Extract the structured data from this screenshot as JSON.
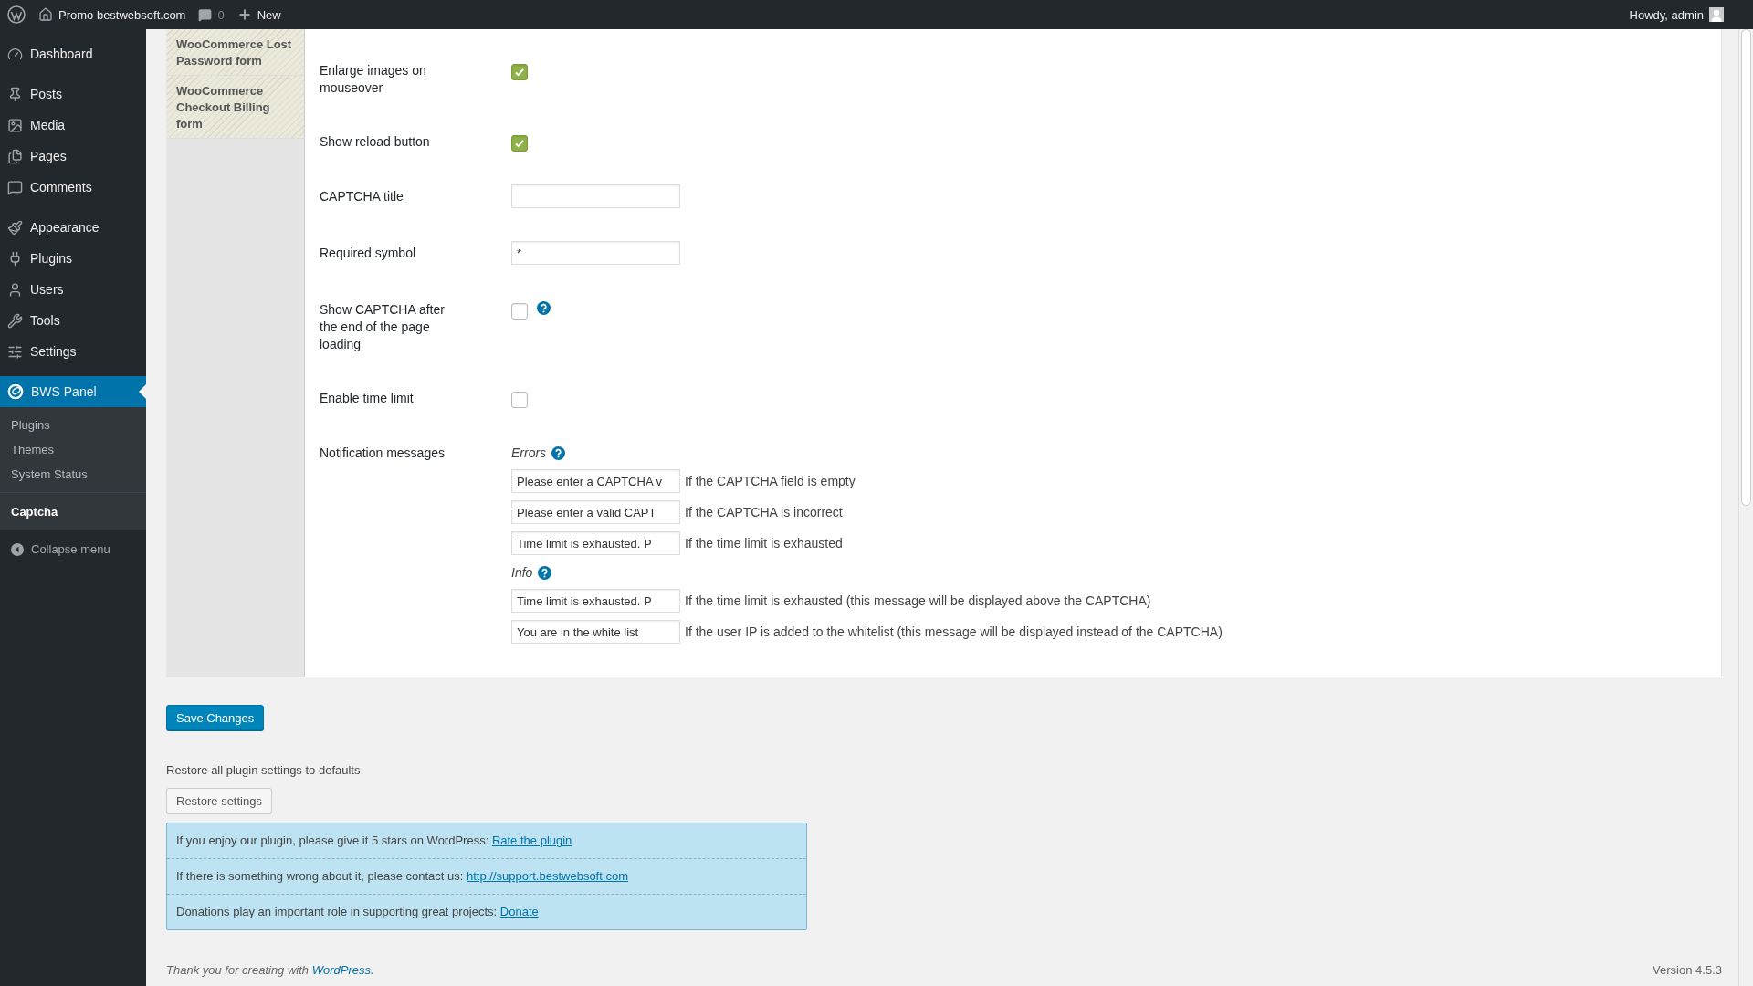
{
  "admin_bar": {
    "site": "Promo bestwebsoft.com",
    "comments": "0",
    "new": "New",
    "greeting": "Howdy, admin"
  },
  "menu": [
    {
      "kind": "top",
      "label": "Dashboard",
      "selected": false
    },
    {
      "kind": "top",
      "label": "Posts",
      "selected": false
    },
    {
      "kind": "top",
      "label": "Media",
      "selected": false
    },
    {
      "kind": "top",
      "label": "Pages",
      "selected": false
    },
    {
      "kind": "top",
      "label": "Comments",
      "selected": false
    },
    {
      "kind": "top",
      "label": "Appearance",
      "selected": false
    },
    {
      "kind": "top",
      "label": "Plugins",
      "selected": false
    },
    {
      "kind": "top",
      "label": "Users",
      "selected": false
    },
    {
      "kind": "top",
      "label": "Tools",
      "selected": false
    },
    {
      "kind": "top",
      "label": "Settings",
      "selected": false
    },
    {
      "kind": "top",
      "label": "BWS Panel",
      "selected": true,
      "children": [
        {
          "label": "Plugins",
          "selected": false
        },
        {
          "label": "Themes",
          "selected": false
        },
        {
          "label": "System Status",
          "selected": false
        }
      ]
    },
    {
      "kind": "plain",
      "label": "Captcha",
      "selected": true
    }
  ],
  "collapse": "Collapse menu",
  "tabs": [
    {
      "label": "WooCommerce Lost Password form",
      "selected": false
    },
    {
      "label": "WooCommerce Checkout Billing form",
      "selected": false
    }
  ],
  "rows": [
    {
      "kind": "checkbox",
      "label": "Enlarge images on mouseover",
      "checked": true,
      "help": false
    },
    {
      "kind": "checkbox",
      "label": "Show reload button",
      "checked": true,
      "help": false
    },
    {
      "kind": "text",
      "label": "CAPTCHA title",
      "value": ""
    },
    {
      "kind": "text",
      "label": "Required symbol",
      "value": "*"
    },
    {
      "kind": "checkbox",
      "label": "Show CAPTCHA after the end of the page loading",
      "checked": false,
      "help": true
    },
    {
      "kind": "checkbox",
      "label": "Enable time limit",
      "checked": false,
      "help": false
    },
    {
      "kind": "messages",
      "label": "Notification messages",
      "groups": [
        {
          "title": "Errors",
          "items": [
            {
              "value": "Please enter a CAPTCHA v",
              "note": "If the CAPTCHA field is empty"
            },
            {
              "value": "Please enter a valid CAPT",
              "note": "If the CAPTCHA is incorrect"
            },
            {
              "value": "Time limit is exhausted. P",
              "note": "If the time limit is exhausted"
            }
          ]
        },
        {
          "title": "Info",
          "items": [
            {
              "value": "Time limit is exhausted. P",
              "note": "If the time limit is exhausted (this message will be displayed above the CAPTCHA)"
            },
            {
              "value": "You are in the white list",
              "note": "If the user IP is added to the whitelist (this message will be displayed instead of the CAPTCHA)"
            }
          ]
        }
      ]
    }
  ],
  "save_button": "Save Changes",
  "restore_text": "Restore all plugin settings to defaults",
  "restore_button": "Restore settings",
  "notices": [
    {
      "text": "If you enjoy our plugin, please give it 5 stars on WordPress: ",
      "link": "Rate the plugin"
    },
    {
      "text": "If there is something wrong about it, please contact us: ",
      "link": "http://support.bestwebsoft.com"
    },
    {
      "text": "Donations play an important role in supporting great projects: ",
      "link": "Donate"
    }
  ],
  "footer": {
    "text": "Thank you for creating with ",
    "link": "WordPress",
    "after": ".",
    "version": "Version 4.5.3"
  }
}
